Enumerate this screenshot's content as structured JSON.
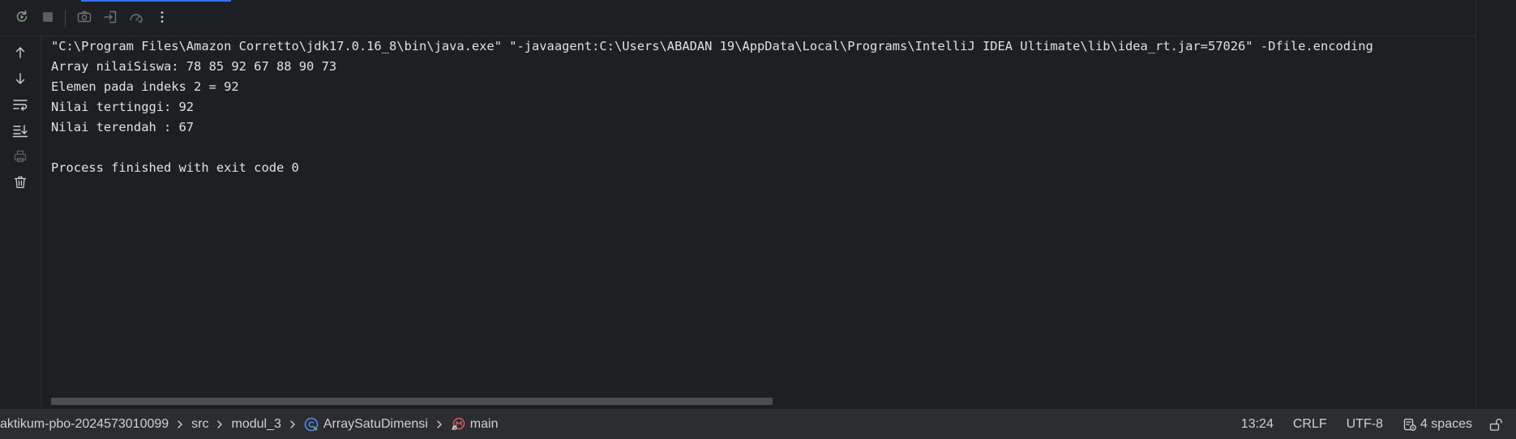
{
  "toolbar": {
    "icons": [
      "rerun-icon",
      "stop-icon",
      "screenshot-icon",
      "restore-layout-icon",
      "profiler-icon",
      "more-options-icon"
    ]
  },
  "side_toolbar": {
    "icons": [
      "scroll-up-icon",
      "scroll-down-icon",
      "soft-wrap-icon",
      "scroll-to-end-icon",
      "print-icon",
      "clear-all-icon"
    ]
  },
  "console": {
    "lines": [
      "\"C:\\Program Files\\Amazon Corretto\\jdk17.0.16_8\\bin\\java.exe\" \"-javaagent:C:\\Users\\ABADAN 19\\AppData\\Local\\Programs\\IntelliJ IDEA Ultimate\\lib\\idea_rt.jar=57026\" -Dfile.encoding",
      "Array nilaiSiswa: 78 85 92 67 88 90 73",
      "Elemen pada indeks 2 = 92",
      "Nilai tertinggi: 92",
      "Nilai terendah : 67",
      "",
      "Process finished with exit code 0"
    ]
  },
  "statusbar": {
    "breadcrumbs": [
      "aktikum-pbo-2024573010099",
      "src",
      "modul_3",
      "ArraySatuDimensi",
      "main"
    ],
    "position": "13:24",
    "line_separator": "CRLF",
    "encoding": "UTF-8",
    "indent": "4 spaces"
  },
  "colors": {
    "background": "#1e1f22",
    "statusbar": "#2b2d30",
    "text": "#dfe1e5",
    "icon": "#8c8e94",
    "accent": "#3574f0"
  }
}
